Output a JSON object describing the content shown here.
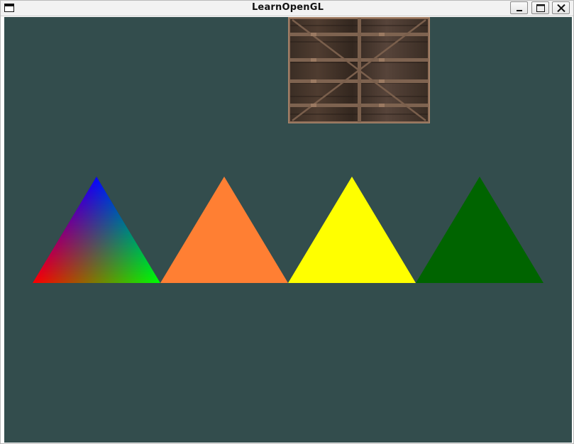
{
  "window": {
    "title": "LearnOpenGL",
    "icon": "window-icon",
    "controls": [
      {
        "name": "minimize-button",
        "icon": "minimize-icon"
      },
      {
        "name": "maximize-button",
        "icon": "maximize-icon"
      },
      {
        "name": "close-button",
        "icon": "close-icon"
      }
    ]
  },
  "scene": {
    "clear_color": "#334d4d",
    "textured_quad": {
      "texture": "wooden-container",
      "wood_colors": [
        "#3a2c24",
        "#5a4334",
        "#7a5d48",
        "#2a201a"
      ]
    },
    "triangles": [
      {
        "name": "vertex-colored-triangle",
        "fill": "gradient",
        "vertex_colors": [
          "#ff0000",
          "#00ff00",
          "#0000ff"
        ]
      },
      {
        "name": "orange-triangle",
        "fill": "#ff7f33"
      },
      {
        "name": "yellow-triangle",
        "fill": "#ffff00"
      },
      {
        "name": "green-triangle",
        "fill": "#006400"
      }
    ]
  }
}
